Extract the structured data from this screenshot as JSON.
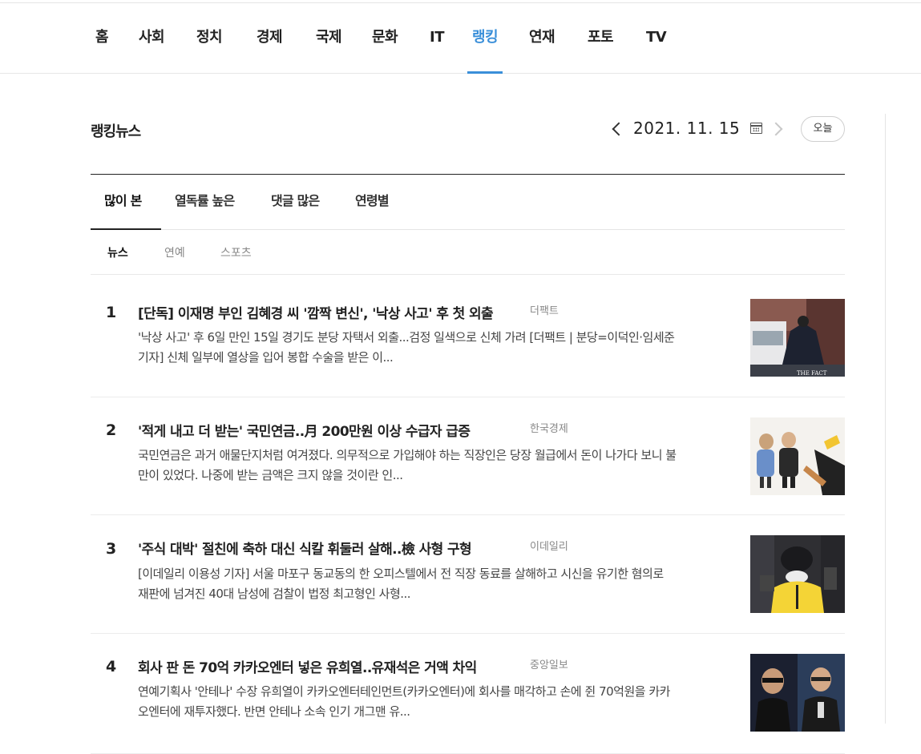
{
  "gnb": {
    "items": [
      "홈",
      "사회",
      "정치",
      "경제",
      "국제",
      "문화",
      "IT",
      "랭킹",
      "연재",
      "포토",
      "TV"
    ],
    "active_index": 7,
    "accent_color": "#3a8fd9"
  },
  "ranking": {
    "title": "랭킹뉴스",
    "date": "2021. 11. 15",
    "today_label": "오늘",
    "tabs": [
      "많이 본",
      "열독률 높은",
      "댓글 많은",
      "연령별"
    ],
    "subtabs": [
      "뉴스",
      "연예",
      "스포츠"
    ]
  },
  "news": [
    {
      "rank": "1",
      "headline": "[단독] 이재명 부인 김혜경 씨 '깜짝 변신', '낙상 사고' 후 첫 외출",
      "press": "더팩트",
      "summary": "'낙상 사고' 후 6일 만인 15일 경기도 분당 자택서 외출...검정 일색으로 신체 가려 [더팩트 | 분당=이덕인·임세준 기자] 신체 일부에 열상을 입어 봉합 수술을 받은 이...",
      "thumb_caption": "THE FACT"
    },
    {
      "rank": "2",
      "headline": "'적게 내고 더 받는' 국민연금..月 200만원 이상 수급자 급증",
      "press": "한국경제",
      "summary": "국민연금은 과거 애물단지처럼 여겨졌다. 의무적으로 가입해야 하는 직장인은 당장 월급에서 돈이 나가다 보니 불만이 있었다. 나중에 받는 금액은 크지 않을 것이란 인..."
    },
    {
      "rank": "3",
      "headline": "'주식 대박' 절친에 축하 대신 식칼 휘둘러 살해..檢 사형 구형",
      "press": "이데일리",
      "summary": "[이데일리 이용성 기자] 서울 마포구 동교동의 한 오피스텔에서 전 직장 동료를 살해하고 시신을 유기한 혐의로 재판에 넘겨진 40대 남성에 검찰이 법정 최고형인 사형..."
    },
    {
      "rank": "4",
      "headline": "회사 판 돈 70억 카카오엔터 넣은 유희열..유재석은 거액 차익",
      "press": "중앙일보",
      "summary": "연예기획사 '안테나' 수장 유희열이 카카오엔터테인먼트(카카오엔터)에 회사를 매각하고 손에 쥔 70억원을 카카오엔터에 재투자했다. 반면 안테나 소속 인기 개그맨 유..."
    }
  ]
}
